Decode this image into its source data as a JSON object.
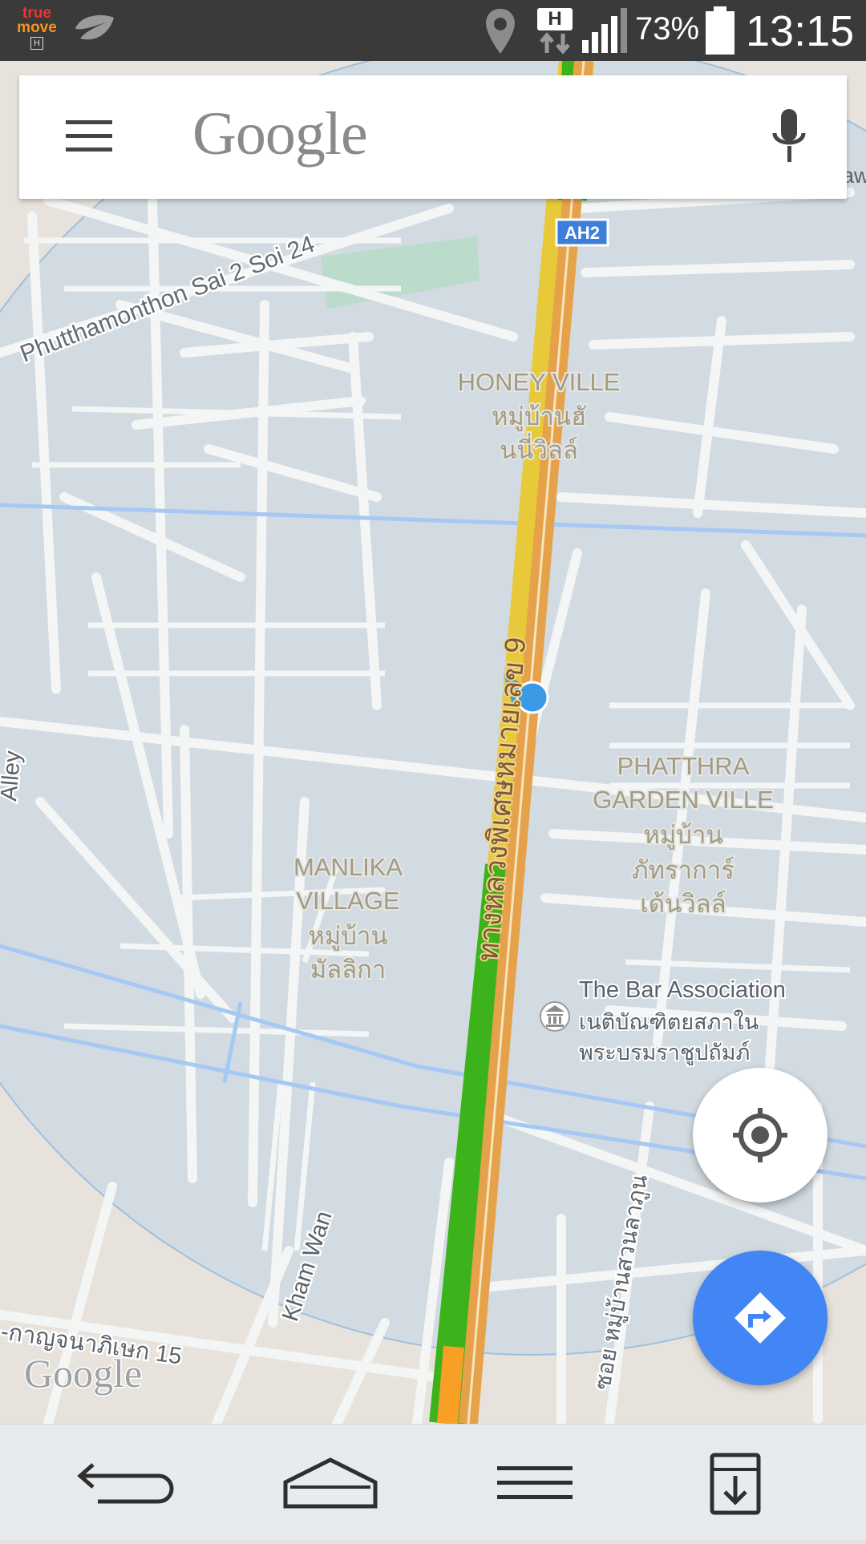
{
  "status_bar": {
    "carrier_top": "true",
    "carrier_bottom": "move",
    "carrier_badge": "H",
    "network_type": "H",
    "battery": "73%",
    "time": "13:15"
  },
  "search": {
    "logo": "Google"
  },
  "map": {
    "road_labels": [
      "Phutthamonthon Sai 2 Soi 24",
      "ทางหลวงพิเศษหมายเลข 9",
      "Kham Wan",
      "ซอย หมู่บ้านสวนลาภูน",
      "-กาญจนาภิเษก 15",
      "Alley",
      "aw"
    ],
    "highway_shield": "AH2",
    "places": [
      {
        "name": "HONEY VILLE",
        "thai_1": "หมู่บ้านฮั",
        "thai_2": "นนี่วิลล์"
      },
      {
        "name": "PHATTHRA",
        "name_2": "GARDEN VILLE",
        "thai_1": "หมู่บ้าน",
        "thai_2": "ภัทราการ์",
        "thai_3": "เด้นวิลล์"
      },
      {
        "name": "MANLIKA",
        "name_2": "VILLAGE",
        "thai_1": "หมู่บ้าน",
        "thai_2": "มัลลิกา"
      },
      {
        "name": "The Bar Association",
        "thai_1": "เนติบัณฑิตยสภาใน",
        "thai_2": "พระบรมราชูปถัมภ์"
      }
    ],
    "watermark": "Google",
    "colors": {
      "traffic_slow": "#e8c93a",
      "traffic_fast": "#3cb31b",
      "highway_core": "#e6a24b",
      "accuracy_circle": "#c9d8e3",
      "water": "#a6c8f5",
      "location_dot": "#3b9ae6"
    }
  },
  "controls": {
    "my_location": "crosshair-icon",
    "directions": "directions-icon",
    "directions_color": "#4285f4"
  },
  "nav_bar": {
    "buttons": [
      "back-icon",
      "home-icon",
      "menu-icon",
      "notes-icon"
    ]
  }
}
